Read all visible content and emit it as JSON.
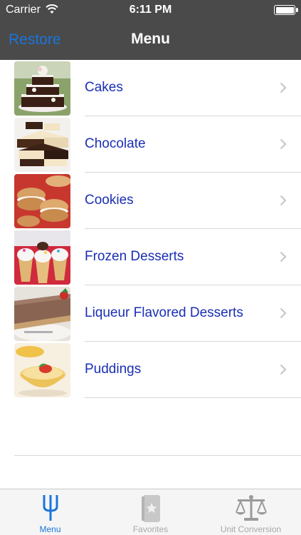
{
  "status_bar": {
    "carrier": "Carrier",
    "time": "6:11 PM"
  },
  "nav": {
    "left_label": "Restore",
    "title": "Menu"
  },
  "items": [
    {
      "label": "Cakes",
      "thumbnail": "tiered-cake-photo"
    },
    {
      "label": "Chocolate",
      "thumbnail": "chocolate-squares-photo"
    },
    {
      "label": "Cookies",
      "thumbnail": "sandwich-cookies-photo"
    },
    {
      "label": "Frozen Desserts",
      "thumbnail": "ice-cream-cones-photo"
    },
    {
      "label": "Liqueur Flavored Desserts",
      "thumbnail": "mousse-pie-photo"
    },
    {
      "label": "Puddings",
      "thumbnail": "pudding-cup-photo"
    }
  ],
  "tabs": [
    {
      "label": "Menu",
      "icon": "fork-icon",
      "active": true
    },
    {
      "label": "Favorites",
      "icon": "star-book-icon",
      "active": false
    },
    {
      "label": "Unit Conversion",
      "icon": "scale-icon",
      "active": false
    }
  ],
  "colors": {
    "nav_bar": "#4a4a4a",
    "accent": "#1a75d9",
    "item_text": "#1a2fb3",
    "tab_inactive": "#a8a8a8"
  }
}
